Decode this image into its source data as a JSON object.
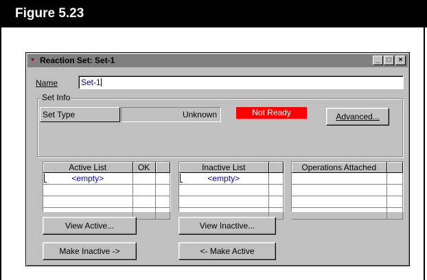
{
  "figure": {
    "label": "Figure 5.23"
  },
  "window": {
    "title": "Reaction Set: Set-1",
    "controls": {
      "minimize": "_",
      "maximize": "□",
      "close": "×"
    }
  },
  "name_field": {
    "label": "Name",
    "value": "Set-1"
  },
  "set_info": {
    "group_label": "Set Info",
    "set_type_label": "Set Type",
    "set_type_value": "Unknown",
    "status": "Not Ready",
    "status_color": "#ff0000",
    "advanced_button": "Advanced..."
  },
  "active_list": {
    "headers": [
      "Active List",
      "OK",
      ""
    ],
    "rows": [
      [
        "<empty>",
        "",
        ""
      ],
      [
        "",
        "",
        ""
      ],
      [
        "",
        "",
        ""
      ],
      [
        "",
        "",
        ""
      ]
    ]
  },
  "inactive_list": {
    "headers": [
      "Inactive List",
      ""
    ],
    "rows": [
      [
        "<empty>",
        ""
      ],
      [
        "",
        ""
      ],
      [
        "",
        ""
      ],
      [
        "",
        ""
      ]
    ]
  },
  "operations_attached": {
    "headers": [
      "Operations Attached",
      ""
    ],
    "rows": [
      [
        "",
        ""
      ],
      [
        "",
        ""
      ],
      [
        "",
        ""
      ],
      [
        "",
        ""
      ]
    ]
  },
  "buttons": {
    "view_active": "View Active...",
    "view_inactive": "View Inactive...",
    "make_inactive": "Make Inactive ->",
    "make_active": "<- Make Active"
  },
  "colors": {
    "dialog_face": "#c0c0c0",
    "titlebar": "#808080",
    "empty_text": "#0000cc"
  }
}
